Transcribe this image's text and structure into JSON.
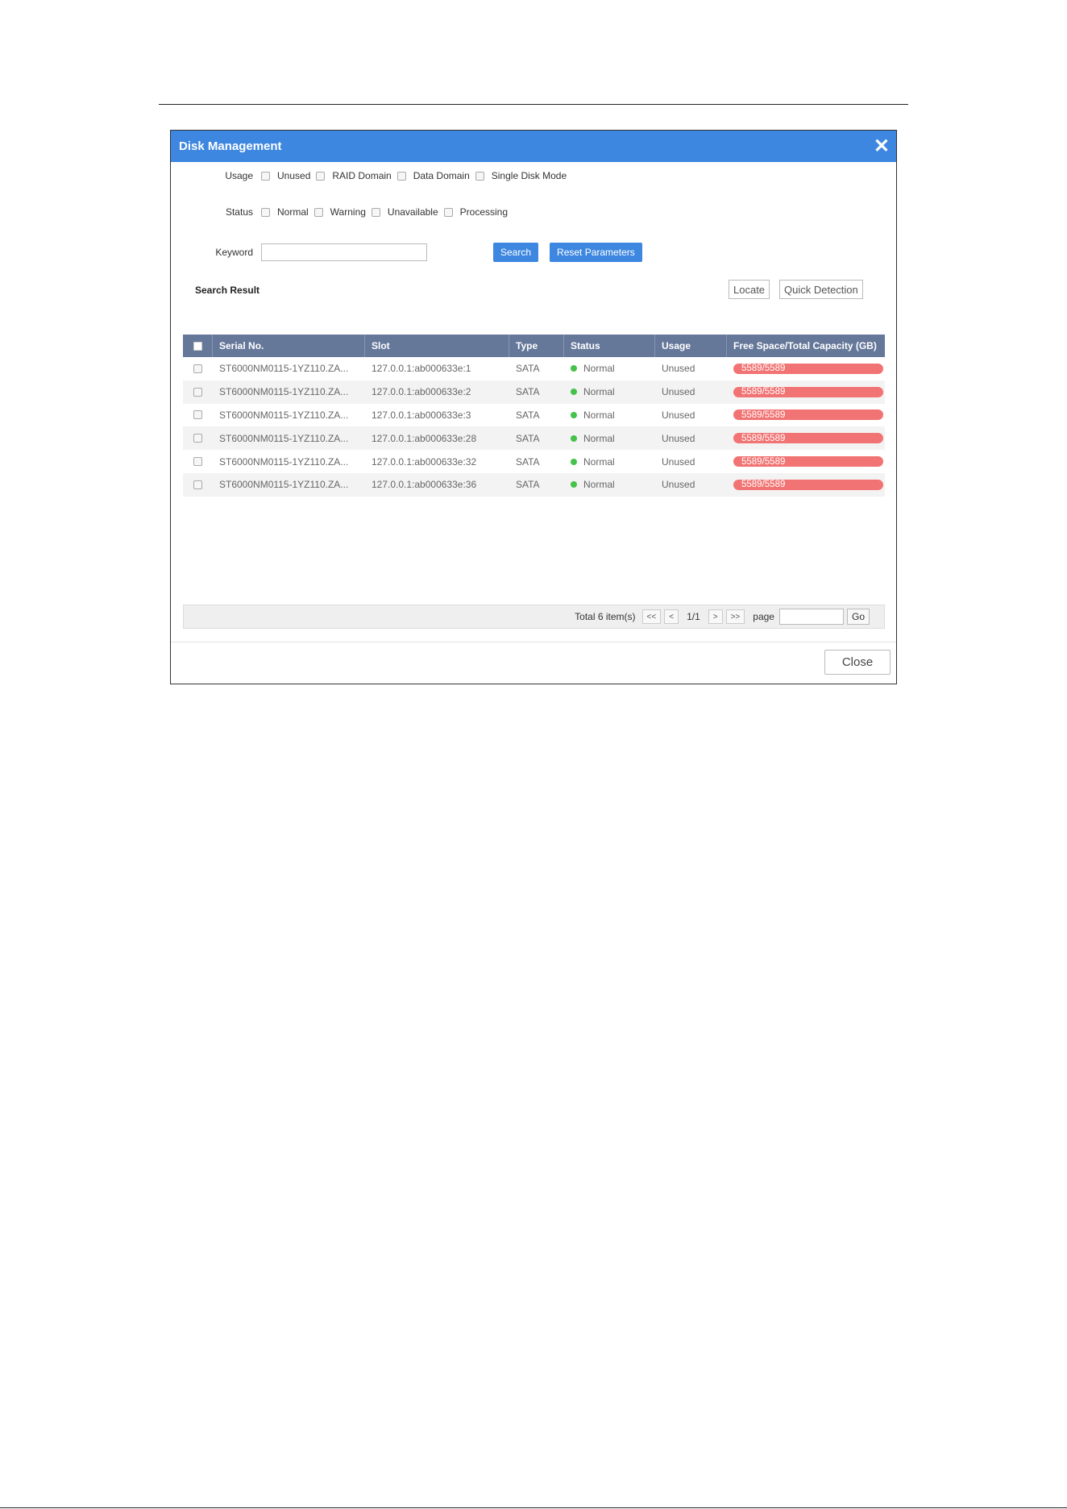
{
  "dialog": {
    "title": "Disk Management"
  },
  "filters": {
    "usage": {
      "label": "Usage",
      "options": [
        "Unused",
        "RAID Domain",
        "Data Domain",
        "Single Disk Mode"
      ]
    },
    "status": {
      "label": "Status",
      "options": [
        "Normal",
        "Warning",
        "Unavailable",
        "Processing"
      ]
    },
    "keyword": {
      "label": "Keyword",
      "value": ""
    },
    "search_label": "Search",
    "reset_label": "Reset Parameters"
  },
  "results": {
    "title": "Search Result",
    "locate_label": "Locate",
    "quick_detection_label": "Quick Detection",
    "columns": [
      "Serial No.",
      "Slot",
      "Type",
      "Status",
      "Usage",
      "Free Space/Total Capacity (GB)"
    ],
    "rows": [
      {
        "serial": "ST6000NM0115-1YZ110.ZA...",
        "slot": "127.0.0.1:ab000633e:1",
        "type": "SATA",
        "status": "Normal",
        "usage": "Unused",
        "capacity": "5589/5589"
      },
      {
        "serial": "ST6000NM0115-1YZ110.ZA...",
        "slot": "127.0.0.1:ab000633e:2",
        "type": "SATA",
        "status": "Normal",
        "usage": "Unused",
        "capacity": "5589/5589"
      },
      {
        "serial": "ST6000NM0115-1YZ110.ZA...",
        "slot": "127.0.0.1:ab000633e:3",
        "type": "SATA",
        "status": "Normal",
        "usage": "Unused",
        "capacity": "5589/5589"
      },
      {
        "serial": "ST6000NM0115-1YZ110.ZA...",
        "slot": "127.0.0.1:ab000633e:28",
        "type": "SATA",
        "status": "Normal",
        "usage": "Unused",
        "capacity": "5589/5589"
      },
      {
        "serial": "ST6000NM0115-1YZ110.ZA...",
        "slot": "127.0.0.1:ab000633e:32",
        "type": "SATA",
        "status": "Normal",
        "usage": "Unused",
        "capacity": "5589/5589"
      },
      {
        "serial": "ST6000NM0115-1YZ110.ZA...",
        "slot": "127.0.0.1:ab000633e:36",
        "type": "SATA",
        "status": "Normal",
        "usage": "Unused",
        "capacity": "5589/5589"
      }
    ]
  },
  "pager": {
    "total": "Total 6 item(s)",
    "first": "<<",
    "prev": "<",
    "current": "1/1",
    "next": ">",
    "last": ">>",
    "page_label": "page",
    "go_label": "Go"
  },
  "footer": {
    "close_label": "Close"
  },
  "colors": {
    "header_blue": "#3d87e0",
    "table_header": "#65789a",
    "status_normal": "#44c24a",
    "capacity_bar": "#f27373"
  }
}
